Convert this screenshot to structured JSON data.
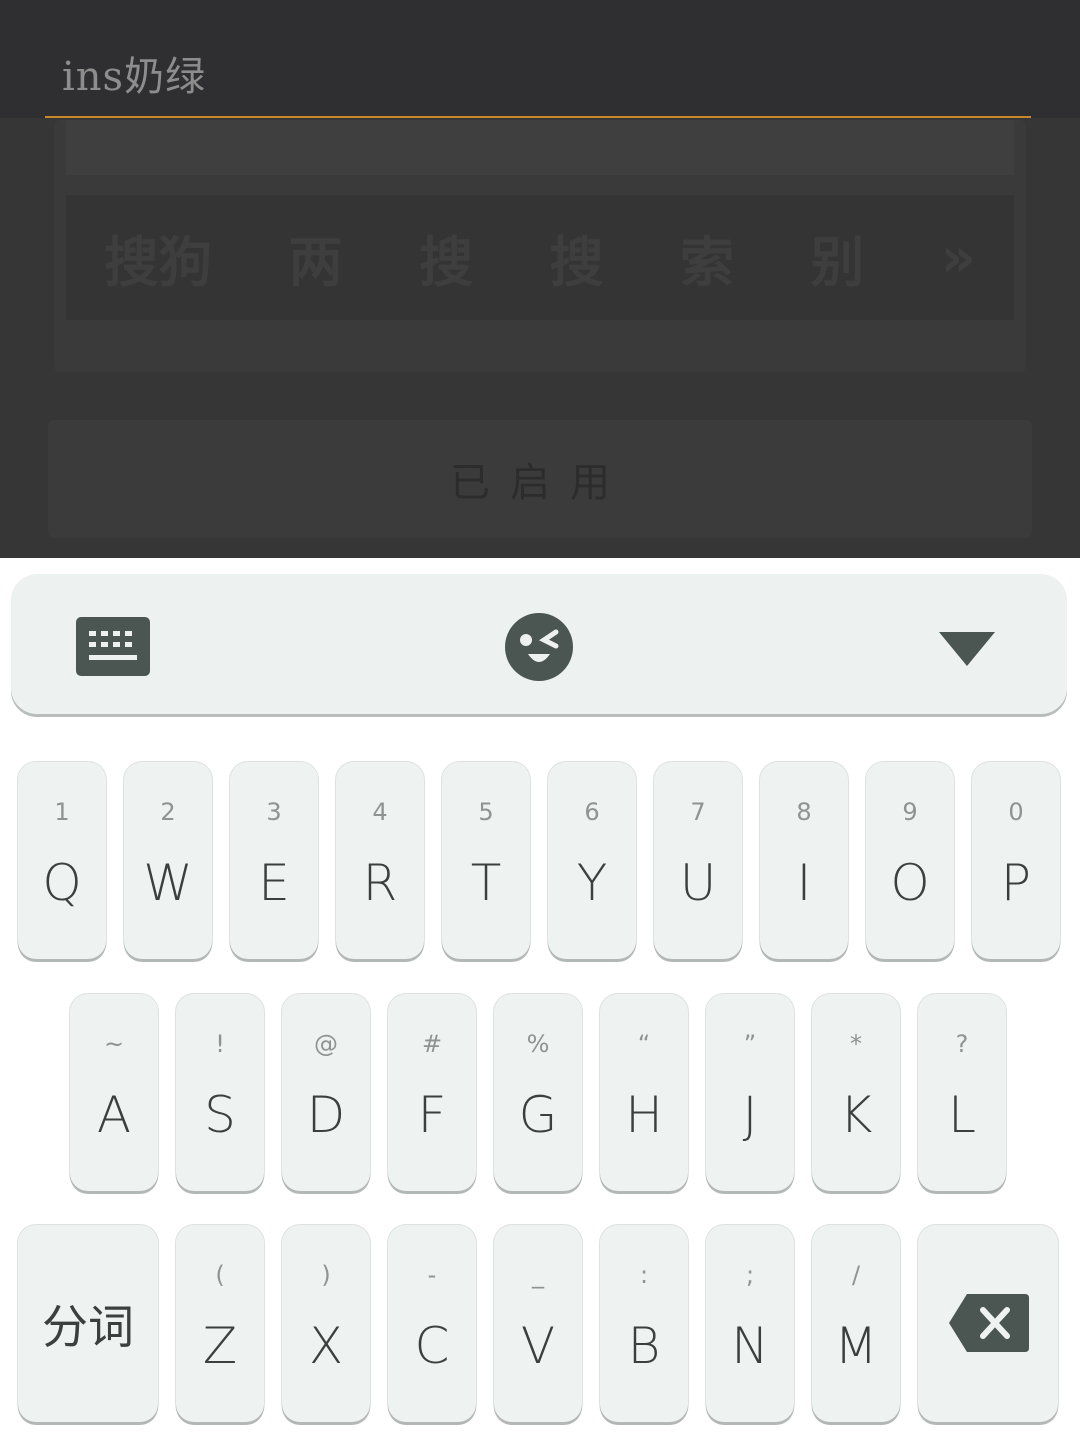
{
  "app": {
    "title": "ins奶绿",
    "candidates": [
      "搜狗",
      "两",
      "搜",
      "搜",
      "索",
      "别"
    ],
    "enabled_label": "已启用"
  },
  "keyboard": {
    "toolbar": {
      "keyboard_icon": "keyboard-icon",
      "emoji_icon": "wink-emoji-icon",
      "collapse_icon": "triangle-down-icon"
    },
    "row1": [
      {
        "main": "Q",
        "sub": "1"
      },
      {
        "main": "W",
        "sub": "2"
      },
      {
        "main": "E",
        "sub": "3"
      },
      {
        "main": "R",
        "sub": "4"
      },
      {
        "main": "T",
        "sub": "5"
      },
      {
        "main": "Y",
        "sub": "6"
      },
      {
        "main": "U",
        "sub": "7"
      },
      {
        "main": "I",
        "sub": "8"
      },
      {
        "main": "O",
        "sub": "9"
      },
      {
        "main": "P",
        "sub": "0"
      }
    ],
    "row2": [
      {
        "main": "A",
        "sub": "~"
      },
      {
        "main": "S",
        "sub": "!"
      },
      {
        "main": "D",
        "sub": "@"
      },
      {
        "main": "F",
        "sub": "#"
      },
      {
        "main": "G",
        "sub": "%"
      },
      {
        "main": "H",
        "sub": "“"
      },
      {
        "main": "J",
        "sub": "”"
      },
      {
        "main": "K",
        "sub": "*"
      },
      {
        "main": "L",
        "sub": "?"
      }
    ],
    "row3": [
      {
        "main": "Z",
        "sub": "("
      },
      {
        "main": "X",
        "sub": ")"
      },
      {
        "main": "C",
        "sub": "-"
      },
      {
        "main": "V",
        "sub": "_"
      },
      {
        "main": "B",
        "sub": ":"
      },
      {
        "main": "N",
        "sub": ";"
      },
      {
        "main": "M",
        "sub": "/"
      }
    ],
    "segment_label": "分词",
    "backspace_icon": "backspace-icon",
    "colors": {
      "key_bg": "#eef2f1",
      "icon": "#4b5552",
      "accent_underline": "#c9862a"
    }
  }
}
